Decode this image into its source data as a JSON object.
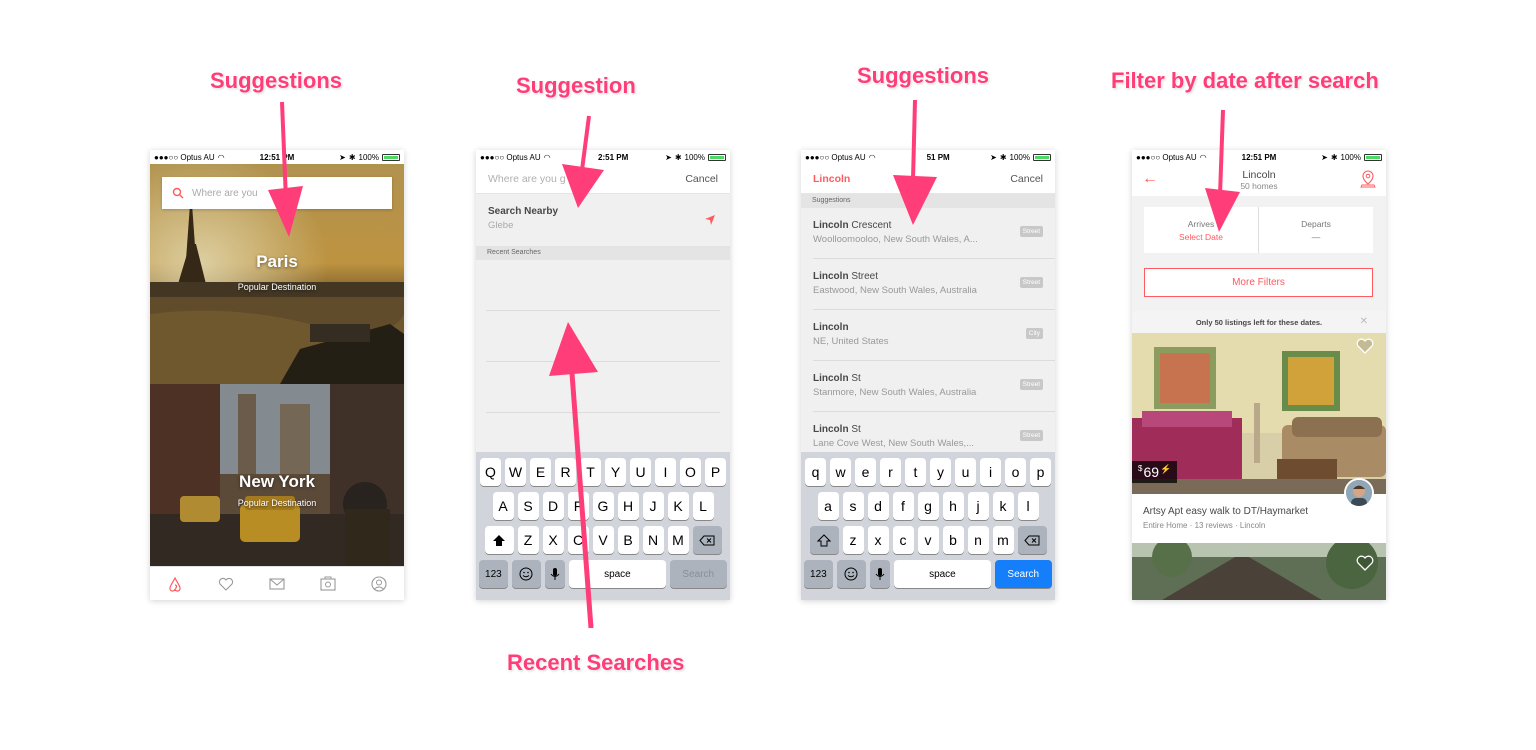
{
  "annotations": {
    "a1": "Suggestions",
    "a2": "Suggestion",
    "a3": "Suggestions",
    "a4": "Filter by date after search",
    "a5": "Recent Searches"
  },
  "status": {
    "carrier": "●●●○○ Optus AU",
    "time": "12:51 PM",
    "time_short": "2:51 PM",
    "time_short3": "51 PM",
    "battery": "100%"
  },
  "phone1": {
    "search_placeholder": "Where are you",
    "destinations": [
      {
        "title": "Paris",
        "subtitle": "Popular Destination"
      },
      {
        "title": "New York",
        "subtitle": "Popular Destination"
      }
    ]
  },
  "phone2": {
    "search_placeholder": "Where are you g",
    "cancel": "Cancel",
    "nearby_title": "Search Nearby",
    "nearby_sub": "Glebe",
    "recent_header": "Recent Searches"
  },
  "phone3": {
    "query": "Lincoln",
    "cancel": "Cancel",
    "section": "Suggestions",
    "items": [
      {
        "bold": "Lincoln",
        "rest": " Crescent",
        "sub": "Woolloomooloo, New South Wales, A...",
        "tag": "Street"
      },
      {
        "bold": "Lincoln",
        "rest": " Street",
        "sub": "Eastwood, New South Wales, Australia",
        "tag": "Street"
      },
      {
        "bold": "Lincoln",
        "rest": "",
        "sub": "NE, United States",
        "tag": "City"
      },
      {
        "bold": "Lincoln",
        "rest": " St",
        "sub": "Stanmore, New South Wales, Australia",
        "tag": "Street"
      },
      {
        "bold": "Lincoln",
        "rest": " St",
        "sub": "Lane Cove West, New South Wales,...",
        "tag": "Street"
      }
    ]
  },
  "phone4": {
    "title": "Lincoln",
    "subtitle": "50 homes",
    "arrives_label": "Arrives",
    "arrives_value": "Select Date",
    "departs_label": "Departs",
    "departs_value": "—",
    "more_filters": "More Filters",
    "notice": "Only 50 listings left for these dates.",
    "price_currency": "$",
    "price_value": "69",
    "listing_title": "Artsy Apt easy walk to DT/Haymarket",
    "listing_sub": "Entire Home · 13 reviews · Lincoln"
  },
  "keyboard_upper": {
    "row1": [
      "Q",
      "W",
      "E",
      "R",
      "T",
      "Y",
      "U",
      "I",
      "O",
      "P"
    ],
    "row2": [
      "A",
      "S",
      "D",
      "F",
      "G",
      "H",
      "J",
      "K",
      "L"
    ],
    "row3": [
      "Z",
      "X",
      "C",
      "V",
      "B",
      "N",
      "M"
    ],
    "num": "123",
    "space": "space",
    "search": "Search"
  },
  "keyboard_lower": {
    "row1": [
      "q",
      "w",
      "e",
      "r",
      "t",
      "y",
      "u",
      "i",
      "o",
      "p"
    ],
    "row2": [
      "a",
      "s",
      "d",
      "f",
      "g",
      "h",
      "j",
      "k",
      "l"
    ],
    "row3": [
      "z",
      "x",
      "c",
      "v",
      "b",
      "n",
      "m"
    ],
    "num": "123",
    "space": "space",
    "search": "Search"
  },
  "colors": {
    "accent": "#ff5a5f",
    "annotation": "#ff3d78",
    "keyboard_search": "#147efb"
  }
}
